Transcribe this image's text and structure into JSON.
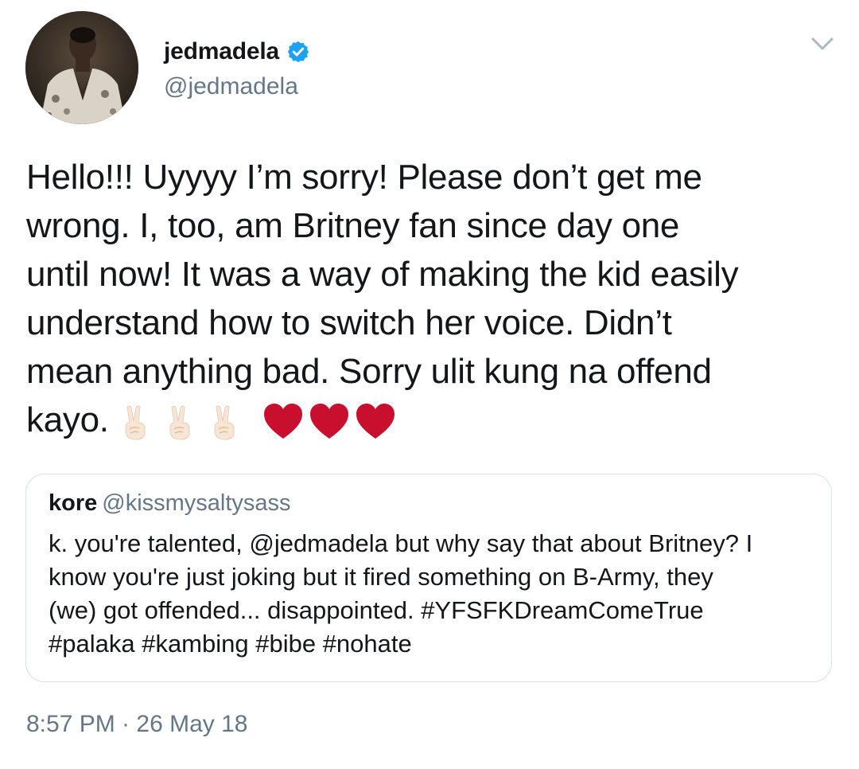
{
  "author": {
    "display_name": "jedmadela",
    "handle": "@jedmadela",
    "verified": true
  },
  "icons": {
    "avatar": "avatar",
    "verified": "verified-badge-icon",
    "menu": "chevron-down-icon",
    "peace": "victory-hand-emoji",
    "heart": "red-heart-emoji"
  },
  "colors": {
    "verified_blue": "#1da1f2",
    "heart_red": "#c8102e",
    "secondary_text": "#657786",
    "border": "#d9e0e6"
  },
  "tweet": {
    "lines": [
      "Hello!!! Uyyyy I’m sorry! Please don’t get me",
      "wrong. I, too, am Britney fan since day one",
      "until now! It was a way of making the kid easily",
      "understand how to switch her voice. Didn’t",
      "mean anything bad. Sorry ulit kung na offend",
      "kayo."
    ]
  },
  "quoted": {
    "name": "kore",
    "handle": "@kissmysaltysass",
    "lines": [
      "k. you're talented, @jedmadela but why say that about Britney? I",
      "know you're just joking but it fired something on B-Army, they",
      "(we) got offended... disappointed. #YFSFKDreamComeTrue",
      "#palaka #kambing #bibe #nohate"
    ]
  },
  "timestamp": "8:57 PM · 26 May 18"
}
